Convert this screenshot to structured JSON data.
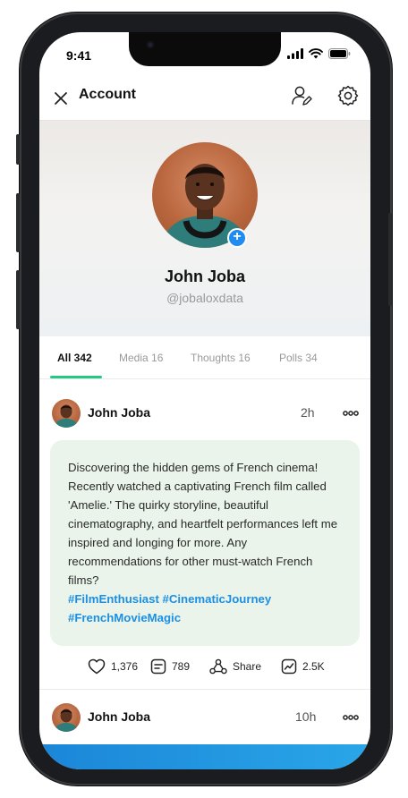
{
  "status_bar": {
    "time": "9:41"
  },
  "header": {
    "title": "Account"
  },
  "profile": {
    "name": "John Joba",
    "handle": "@jobaloxdata",
    "add_badge": "+"
  },
  "tabs": [
    {
      "label": "All 342",
      "active": true
    },
    {
      "label": "Media 16",
      "active": false
    },
    {
      "label": "Thoughts 16",
      "active": false
    },
    {
      "label": "Polls 34",
      "active": false
    }
  ],
  "posts": [
    {
      "author": "John Joba",
      "time": "2h",
      "text": "Discovering the hidden gems of French cinema! Recently watched a captivating French film called 'Amelie.' The quirky storyline, beautiful cinematography, and heartfelt performances left me inspired and longing for more. Any recommendations for other must-watch French films?",
      "hashtags": "#FilmEnthusiast #CinematicJourney #FrenchMovieMagic",
      "likes": "1,376",
      "comments": "789",
      "share_label": "Share",
      "views": "2.5K"
    },
    {
      "author": "John Joba",
      "time": "10h"
    }
  ],
  "colors": {
    "accent_green": "#22c985",
    "hashtag_blue": "#1c8fe3",
    "badge_blue": "#1e8cf0",
    "post_bg": "#eaf4ea"
  }
}
